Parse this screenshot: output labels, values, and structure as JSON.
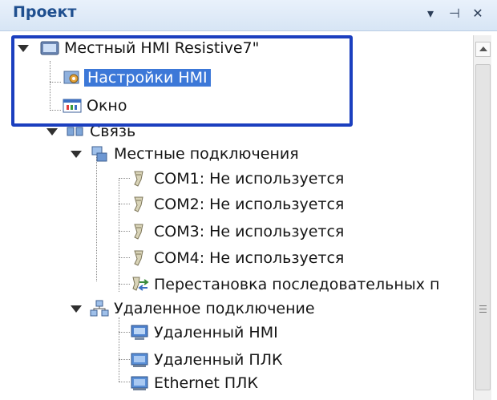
{
  "panel": {
    "title": "Проект",
    "buttons": {
      "dropdown": "▾",
      "pin": "⊣",
      "close": "✕"
    }
  },
  "tree": {
    "root": {
      "label": "Местный HMI Resistive7\""
    },
    "settings": {
      "label": "Настройки HMI",
      "selected": true
    },
    "window": {
      "label": "Окно"
    },
    "connection": {
      "label": "Связь"
    },
    "local_connections": {
      "label": "Местные подключения"
    },
    "com1": {
      "label": "COM1: Не используется"
    },
    "com2": {
      "label": "COM2: Не используется"
    },
    "com3": {
      "label": "COM3: Не используется"
    },
    "com4": {
      "label": "COM4: Не используется"
    },
    "serial_swap": {
      "label": "Перестановка последовательных п"
    },
    "remote_connection": {
      "label": "Удаленное подключение"
    },
    "remote_hmi": {
      "label": "Удаленный HMI"
    },
    "remote_plc": {
      "label": "Удаленный ПЛК"
    },
    "ethernet_plc": {
      "label": "Ethernet ПЛК"
    }
  },
  "colors": {
    "selection": "#3c78d8",
    "highlight_border": "#1b3fbf",
    "title_text": "#1f4f8f"
  }
}
